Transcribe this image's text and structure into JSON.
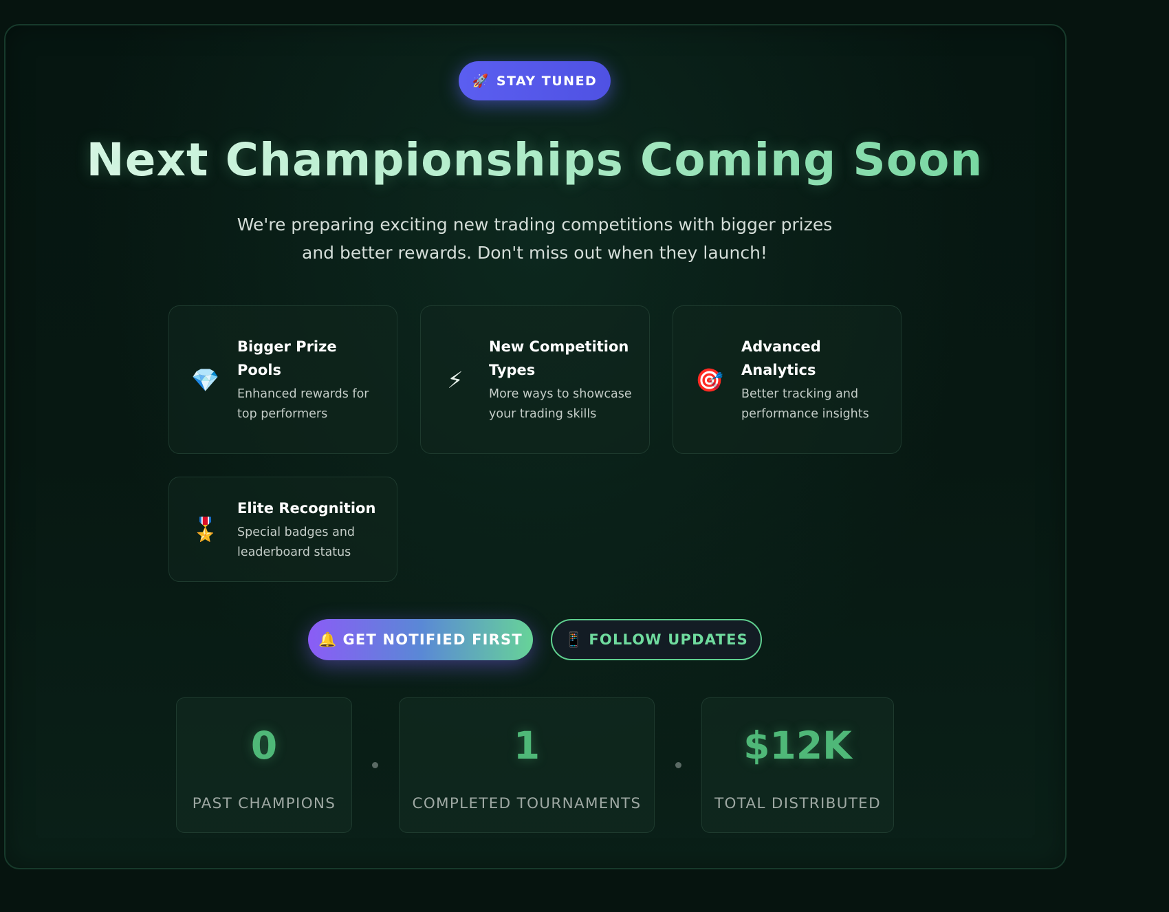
{
  "badge": {
    "icon": "🚀",
    "label": "STAY TUNED"
  },
  "title": "Next Championships Coming Soon",
  "subtitle": "We're preparing exciting new trading competitions with bigger prizes and better rewards. Don't miss out when they launch!",
  "features": [
    {
      "icon": "💎",
      "icon_name": "gem-icon",
      "title": "Bigger Prize Pools",
      "description": "Enhanced rewards for top performers"
    },
    {
      "icon": "⚡",
      "icon_name": "lightning-icon",
      "title": "New Competition Types",
      "description": "More ways to showcase your trading skills"
    },
    {
      "icon": "🎯",
      "icon_name": "target-icon",
      "title": "Advanced Analytics",
      "description": "Better tracking and performance insights"
    },
    {
      "icon": "🎖️",
      "icon_name": "medal-icon",
      "title": "Elite Recognition",
      "description": "Special badges and leaderboard status"
    }
  ],
  "actions": {
    "notify": {
      "icon": "🔔",
      "label": "GET NOTIFIED FIRST"
    },
    "follow": {
      "icon": "📱",
      "label": "FOLLOW UPDATES"
    }
  },
  "stats": [
    {
      "value": "0",
      "label": "PAST CHAMPIONS"
    },
    {
      "value": "1",
      "label": "COMPLETED TOURNAMENTS"
    },
    {
      "value": "$12K",
      "label": "TOTAL DISTRIBUTED"
    }
  ],
  "colors": {
    "background": "#06140f",
    "accent_green": "#5fcf8f",
    "badge_blue": "#5b5ef0",
    "gradient_purple": "#8b5cf6"
  }
}
